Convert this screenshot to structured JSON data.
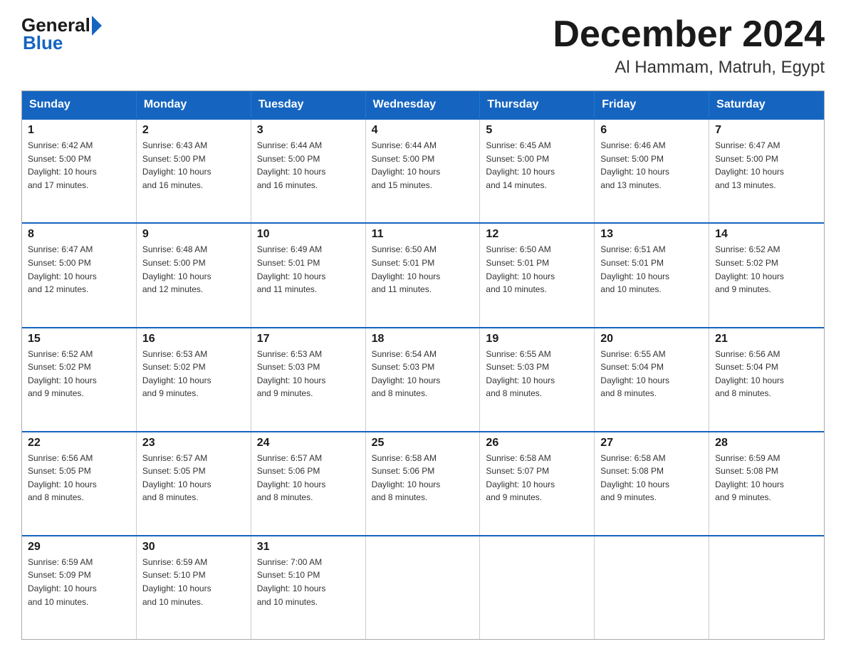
{
  "header": {
    "logo_general": "General",
    "logo_blue": "Blue",
    "month_title": "December 2024",
    "location": "Al Hammam, Matruh, Egypt"
  },
  "days_of_week": [
    "Sunday",
    "Monday",
    "Tuesday",
    "Wednesday",
    "Thursday",
    "Friday",
    "Saturday"
  ],
  "weeks": [
    [
      {
        "num": "1",
        "info": "Sunrise: 6:42 AM\nSunset: 5:00 PM\nDaylight: 10 hours\nand 17 minutes."
      },
      {
        "num": "2",
        "info": "Sunrise: 6:43 AM\nSunset: 5:00 PM\nDaylight: 10 hours\nand 16 minutes."
      },
      {
        "num": "3",
        "info": "Sunrise: 6:44 AM\nSunset: 5:00 PM\nDaylight: 10 hours\nand 16 minutes."
      },
      {
        "num": "4",
        "info": "Sunrise: 6:44 AM\nSunset: 5:00 PM\nDaylight: 10 hours\nand 15 minutes."
      },
      {
        "num": "5",
        "info": "Sunrise: 6:45 AM\nSunset: 5:00 PM\nDaylight: 10 hours\nand 14 minutes."
      },
      {
        "num": "6",
        "info": "Sunrise: 6:46 AM\nSunset: 5:00 PM\nDaylight: 10 hours\nand 13 minutes."
      },
      {
        "num": "7",
        "info": "Sunrise: 6:47 AM\nSunset: 5:00 PM\nDaylight: 10 hours\nand 13 minutes."
      }
    ],
    [
      {
        "num": "8",
        "info": "Sunrise: 6:47 AM\nSunset: 5:00 PM\nDaylight: 10 hours\nand 12 minutes."
      },
      {
        "num": "9",
        "info": "Sunrise: 6:48 AM\nSunset: 5:00 PM\nDaylight: 10 hours\nand 12 minutes."
      },
      {
        "num": "10",
        "info": "Sunrise: 6:49 AM\nSunset: 5:01 PM\nDaylight: 10 hours\nand 11 minutes."
      },
      {
        "num": "11",
        "info": "Sunrise: 6:50 AM\nSunset: 5:01 PM\nDaylight: 10 hours\nand 11 minutes."
      },
      {
        "num": "12",
        "info": "Sunrise: 6:50 AM\nSunset: 5:01 PM\nDaylight: 10 hours\nand 10 minutes."
      },
      {
        "num": "13",
        "info": "Sunrise: 6:51 AM\nSunset: 5:01 PM\nDaylight: 10 hours\nand 10 minutes."
      },
      {
        "num": "14",
        "info": "Sunrise: 6:52 AM\nSunset: 5:02 PM\nDaylight: 10 hours\nand 9 minutes."
      }
    ],
    [
      {
        "num": "15",
        "info": "Sunrise: 6:52 AM\nSunset: 5:02 PM\nDaylight: 10 hours\nand 9 minutes."
      },
      {
        "num": "16",
        "info": "Sunrise: 6:53 AM\nSunset: 5:02 PM\nDaylight: 10 hours\nand 9 minutes."
      },
      {
        "num": "17",
        "info": "Sunrise: 6:53 AM\nSunset: 5:03 PM\nDaylight: 10 hours\nand 9 minutes."
      },
      {
        "num": "18",
        "info": "Sunrise: 6:54 AM\nSunset: 5:03 PM\nDaylight: 10 hours\nand 8 minutes."
      },
      {
        "num": "19",
        "info": "Sunrise: 6:55 AM\nSunset: 5:03 PM\nDaylight: 10 hours\nand 8 minutes."
      },
      {
        "num": "20",
        "info": "Sunrise: 6:55 AM\nSunset: 5:04 PM\nDaylight: 10 hours\nand 8 minutes."
      },
      {
        "num": "21",
        "info": "Sunrise: 6:56 AM\nSunset: 5:04 PM\nDaylight: 10 hours\nand 8 minutes."
      }
    ],
    [
      {
        "num": "22",
        "info": "Sunrise: 6:56 AM\nSunset: 5:05 PM\nDaylight: 10 hours\nand 8 minutes."
      },
      {
        "num": "23",
        "info": "Sunrise: 6:57 AM\nSunset: 5:05 PM\nDaylight: 10 hours\nand 8 minutes."
      },
      {
        "num": "24",
        "info": "Sunrise: 6:57 AM\nSunset: 5:06 PM\nDaylight: 10 hours\nand 8 minutes."
      },
      {
        "num": "25",
        "info": "Sunrise: 6:58 AM\nSunset: 5:06 PM\nDaylight: 10 hours\nand 8 minutes."
      },
      {
        "num": "26",
        "info": "Sunrise: 6:58 AM\nSunset: 5:07 PM\nDaylight: 10 hours\nand 9 minutes."
      },
      {
        "num": "27",
        "info": "Sunrise: 6:58 AM\nSunset: 5:08 PM\nDaylight: 10 hours\nand 9 minutes."
      },
      {
        "num": "28",
        "info": "Sunrise: 6:59 AM\nSunset: 5:08 PM\nDaylight: 10 hours\nand 9 minutes."
      }
    ],
    [
      {
        "num": "29",
        "info": "Sunrise: 6:59 AM\nSunset: 5:09 PM\nDaylight: 10 hours\nand 10 minutes."
      },
      {
        "num": "30",
        "info": "Sunrise: 6:59 AM\nSunset: 5:10 PM\nDaylight: 10 hours\nand 10 minutes."
      },
      {
        "num": "31",
        "info": "Sunrise: 7:00 AM\nSunset: 5:10 PM\nDaylight: 10 hours\nand 10 minutes."
      },
      {
        "num": "",
        "info": ""
      },
      {
        "num": "",
        "info": ""
      },
      {
        "num": "",
        "info": ""
      },
      {
        "num": "",
        "info": ""
      }
    ]
  ]
}
